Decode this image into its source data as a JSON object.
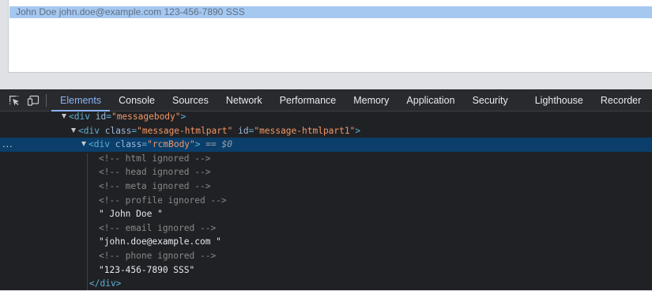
{
  "preview": {
    "selected_text": "John Doe john.doe@example.com 123-456-7890 SSS"
  },
  "devtools": {
    "tabs": [
      {
        "label": "Elements",
        "active": true
      },
      {
        "label": "Console"
      },
      {
        "label": "Sources"
      },
      {
        "label": "Network"
      },
      {
        "label": "Performance"
      },
      {
        "label": "Memory"
      },
      {
        "label": "Application"
      },
      {
        "label": "Security"
      },
      {
        "label": "Lighthouse"
      },
      {
        "label": "Recorder"
      }
    ],
    "tree": {
      "messagebody_tag": "div",
      "messagebody_attr": "id",
      "messagebody_val": "\"messagebody\"",
      "htmlpart_tag": "div",
      "htmlpart_class_attr": "class",
      "htmlpart_class_val": "\"message-htmlpart\"",
      "htmlpart_id_attr": "id",
      "htmlpart_id_val": "\"message-htmlpart1\"",
      "rcm_tag": "div",
      "rcm_attr": "class",
      "rcm_val": "\"rcmBody\"",
      "rcm_marker": "== $0",
      "selected_dots": "...",
      "c_html": "<!-- html ignored -->",
      "c_head": "<!-- head ignored -->",
      "c_meta": "<!-- meta ignored -->",
      "c_profile": "<!-- profile ignored -->",
      "t_name": "\" John Doe \"",
      "c_email": "<!-- email ignored -->",
      "t_email": "\"john.doe@example.com \"",
      "c_phone": "<!-- phone ignored -->",
      "t_phone": "\"123-456-7890 SSS\"",
      "close_div": "</div>"
    }
  },
  "colors": {
    "selection": "#a5c8f0",
    "active_tab": "#8ab4f8",
    "selected_row": "#0b3e6a",
    "tag": "#5db0d7",
    "attr_value": "#f29766"
  }
}
